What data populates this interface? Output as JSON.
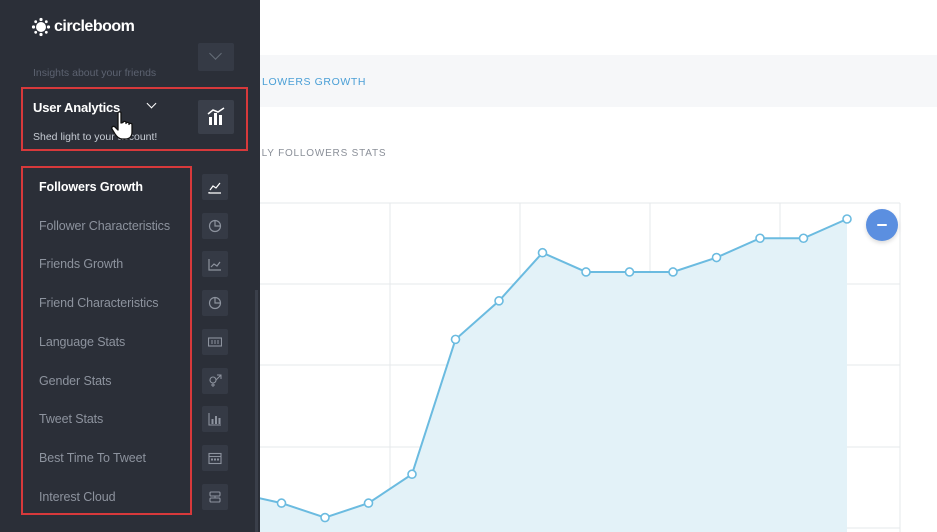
{
  "brand": {
    "name": "circleboom"
  },
  "sidebar": {
    "faded_section": {
      "subtitle": "Insights about your friends"
    },
    "user_analytics": {
      "title": "User Analytics",
      "subtitle": "Shed light to your account!"
    },
    "items": [
      {
        "label": "Followers Growth",
        "icon": "line-chart-icon",
        "active": true
      },
      {
        "label": "Follower Characteristics",
        "icon": "pie-chart-icon",
        "active": false
      },
      {
        "label": "Friends Growth",
        "icon": "growth-chart-icon",
        "active": false
      },
      {
        "label": "Friend Characteristics",
        "icon": "pie-chart-icon",
        "active": false
      },
      {
        "label": "Language Stats",
        "icon": "language-icon",
        "active": false
      },
      {
        "label": "Gender Stats",
        "icon": "gender-icon",
        "active": false
      },
      {
        "label": "Tweet Stats",
        "icon": "bar-chart-icon",
        "active": false
      },
      {
        "label": "Best Time To Tweet",
        "icon": "calendar-icon",
        "active": false
      },
      {
        "label": "Interest Cloud",
        "icon": "cloud-icon",
        "active": false
      }
    ]
  },
  "main": {
    "tab_label": "LOWERS GROWTH",
    "section_title": "ILY FOLLOWERS STATS"
  },
  "colors": {
    "sidebar_bg": "#2b2f38",
    "highlight_border": "#d7393b",
    "accent_blue": "#4a9fd6",
    "line": "#6bbbe0",
    "area_fill": "#e3f2f8",
    "button_blue": "#5b8fe0"
  },
  "chart_data": {
    "type": "area",
    "title": "",
    "xlabel": "",
    "ylabel": "",
    "grid": true,
    "series": [
      {
        "values": [
          4,
          3,
          1.5,
          3,
          6,
          20,
          24,
          29,
          27,
          27,
          27,
          28.5,
          30.5,
          30.5,
          32.5
        ]
      }
    ],
    "ylim": [
      0,
      35
    ]
  }
}
